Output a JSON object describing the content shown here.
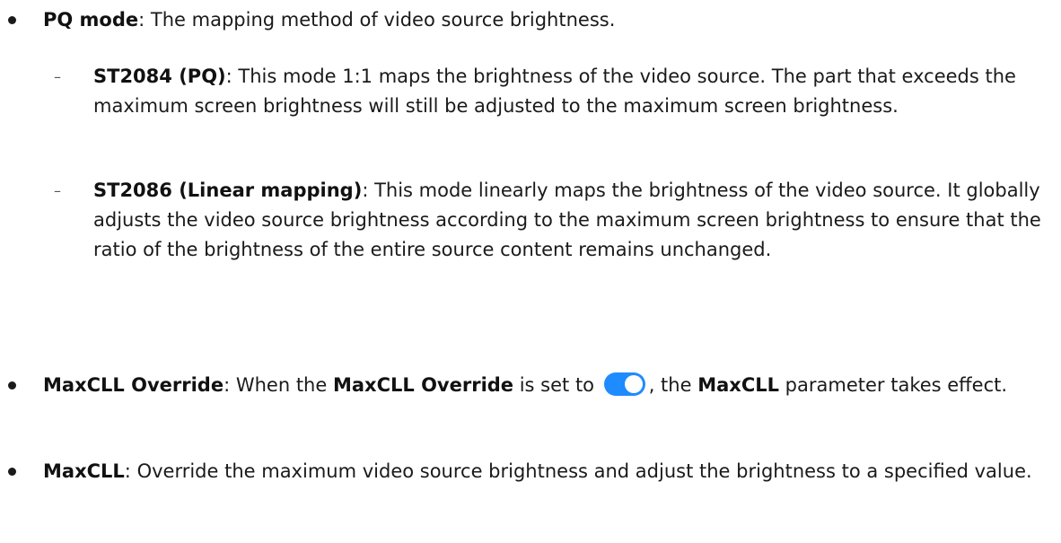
{
  "items": [
    {
      "term": "PQ mode",
      "sep": ": ",
      "desc": "The mapping method of video source brightness."
    },
    {
      "term": "MaxCLL Override",
      "sep": ": ",
      "desc_before": "When the ",
      "inline_term": "MaxCLL Override",
      "desc_mid": " is set to ",
      "toggle_state": "on",
      "desc_mid2": ", the ",
      "inline_term2": "MaxCLL",
      "desc_after": " parameter takes effect."
    },
    {
      "term": "MaxCLL",
      "sep": ": ",
      "desc": "Override the maximum video source brightness and adjust the brightness to a specified value."
    }
  ],
  "sub_items": [
    {
      "marker": "–",
      "term": "ST2084 (PQ)",
      "sep": ": ",
      "desc": "This mode 1:1 maps the brightness of the video source. The part that exceeds the maximum screen brightness will still be adjusted to the maximum screen brightness."
    },
    {
      "marker": "–",
      "term": "ST2086 (Linear mapping)",
      "sep": ": ",
      "desc": "This mode linearly maps the brightness of the video source. It globally adjusts the video source brightness according to the maximum screen brightness to ensure that the ratio of the brightness of the entire source content remains unchanged."
    }
  ],
  "colors": {
    "toggle_on": "#1e8bff"
  },
  "icons": {
    "toggle": "toggle-switch-on-icon"
  }
}
